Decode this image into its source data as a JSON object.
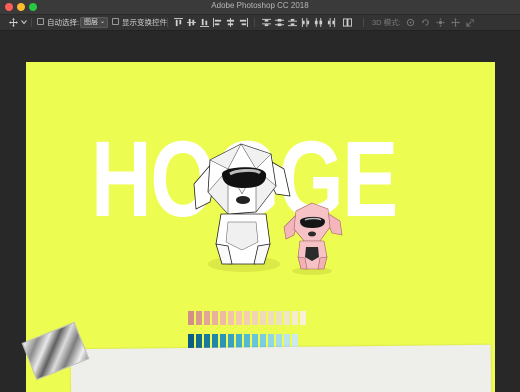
{
  "window": {
    "title": "Adobe Photoshop CC 2018"
  },
  "options_bar": {
    "auto_select_label": "自动选择:",
    "layer_select_value": "图层",
    "show_transform_label": "显示变换控件",
    "mode_3d_label": "3D 模式:"
  },
  "artboard": {
    "background_color": "#edfc50",
    "headline": "HOGGE",
    "headline_color": "#ffffff",
    "warm_swatches": [
      "#d28f86",
      "#d99a8d",
      "#e2a597",
      "#e9b09e",
      "#eebaa4",
      "#f1c3ab",
      "#f4c8af",
      "#f4cdb3",
      "#f3d3b8",
      "#f1d7bb",
      "#eedcbd",
      "#ebe0c0",
      "#f0e6c7",
      "#f5ebce",
      "#f8f0d8"
    ],
    "cool_swatches": [
      "#0b5f86",
      "#136c93",
      "#1a799f",
      "#2286ac",
      "#2c93b9",
      "#39a0c3",
      "#47adcc",
      "#55b9d4",
      "#68c4da",
      "#7dcde0",
      "#93d5e5",
      "#a7dce9",
      "#bbe3ed",
      "#cde9f0"
    ]
  }
}
